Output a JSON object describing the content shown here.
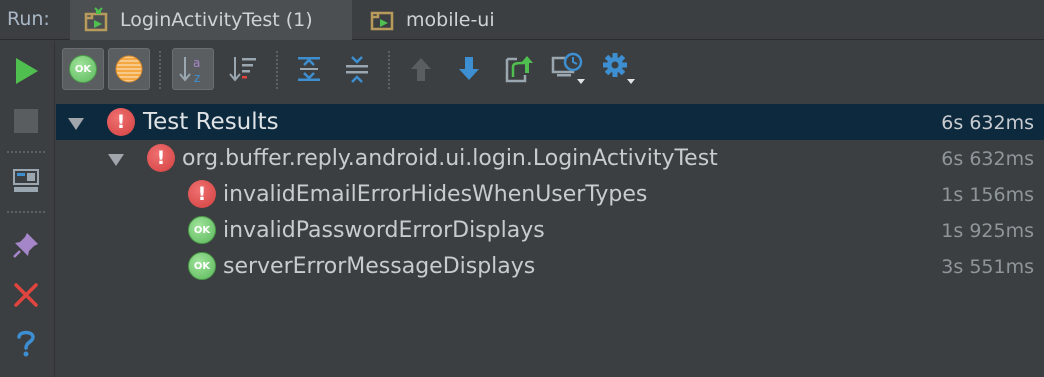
{
  "tabbar": {
    "run_label": "Run:",
    "tabs": [
      {
        "label": "LoginActivityTest (1)",
        "icon": "android-run-config-icon",
        "active": true
      },
      {
        "label": "mobile-ui",
        "icon": "android-run-config-icon",
        "active": false
      }
    ]
  },
  "left_toolbar": {
    "items": [
      "rerun-icon",
      "stop-icon",
      "layout-icon",
      "pin-icon",
      "close-icon",
      "help-icon"
    ]
  },
  "toolbar": {
    "items": [
      "show-passed-icon",
      "show-ignored-icon",
      "sort-alphabetically-icon",
      "sort-by-duration-icon",
      "expand-all-icon",
      "collapse-all-icon",
      "previous-failed-icon",
      "next-failed-icon",
      "export-results-icon",
      "test-history-icon",
      "settings-icon"
    ],
    "ok_badge": "OK"
  },
  "tree": {
    "root": {
      "name": "Test Results",
      "time": "6s 632ms",
      "status": "failed"
    },
    "suite": {
      "name": "org.buffer.reply.android.ui.login.LoginActivityTest",
      "time": "6s 632ms",
      "status": "failed"
    },
    "tests": [
      {
        "name": "invalidEmailErrorHidesWhenUserTypes",
        "time": "1s 156ms",
        "status": "failed"
      },
      {
        "name": "invalidPasswordErrorDisplays",
        "time": "1s 925ms",
        "status": "passed"
      },
      {
        "name": "serverErrorMessageDisplays",
        "time": "3s 551ms",
        "status": "passed"
      }
    ],
    "ok_text": "OK",
    "error_text": "!"
  },
  "colors": {
    "background": "#3c3f41",
    "selection": "#0d293e",
    "error": "#d24040",
    "success": "#5cb85c",
    "run_green": "#4fc04f",
    "icon_blue": "#3d8fd1",
    "close_red": "#e0443e"
  }
}
